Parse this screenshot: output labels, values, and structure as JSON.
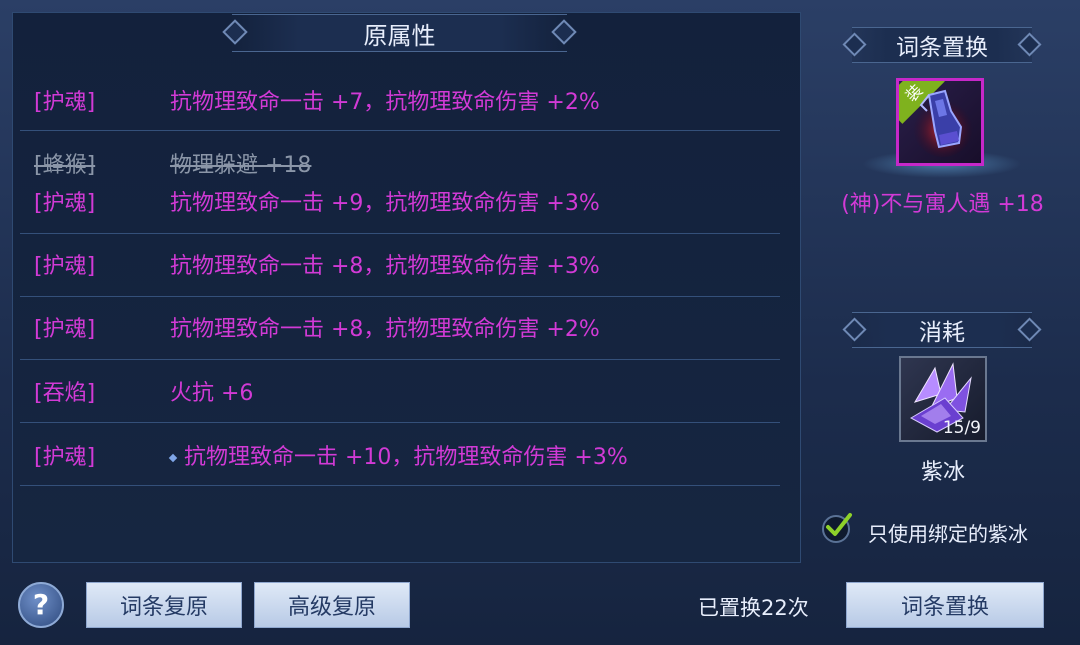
{
  "left_panel": {
    "title": "原属性",
    "rows": [
      {
        "tag": "[护魂]",
        "attr": "抗物理致命一击 +7，抗物理致命伤害 +2%"
      },
      {
        "old_tag": "[蜂猴]",
        "old_attr": "物理躲避 +18",
        "tag": "[护魂]",
        "attr": "抗物理致命一击 +9，抗物理致命伤害 +3%"
      },
      {
        "tag": "[护魂]",
        "attr": "抗物理致命一击 +8，抗物理致命伤害 +3%"
      },
      {
        "tag": "[护魂]",
        "attr": "抗物理致命一击 +8，抗物理致命伤害 +2%"
      },
      {
        "tag": "[吞焰]",
        "attr": "火抗 +6"
      },
      {
        "tag": "[护魂]",
        "attr": "抗物理致命一击 +10，抗物理致命伤害 +3%"
      }
    ]
  },
  "right_panel": {
    "replace_title": "词条置换",
    "equip_badge": "装",
    "equip_icon": "boots-icon",
    "equip_name": "(神)不与寓人遇 +18",
    "consume_title": "消耗",
    "item_icon": "purple-crystal-icon",
    "item_count": "15/9",
    "item_name": "紫冰",
    "checkbox_label": "只使用绑定的紫冰",
    "checkbox_checked": true
  },
  "footer": {
    "help_label": "?",
    "restore_label": "词条复原",
    "advanced_restore_label": "高级复原",
    "replace_count_text": "已置换22次",
    "replace_button_label": "词条置换"
  },
  "colors": {
    "purple_text": "#d23ad6",
    "strike_text": "#8b96a8",
    "check_green": "#8ed12a"
  }
}
